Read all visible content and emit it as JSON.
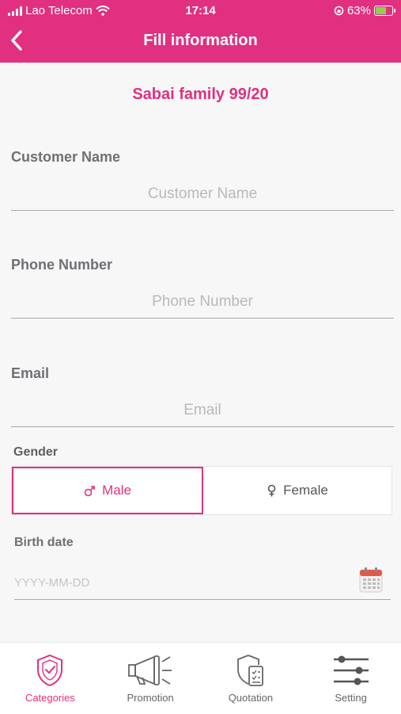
{
  "status": {
    "carrier": "Lao Telecom",
    "time": "17:14",
    "battery": "63%"
  },
  "header": {
    "title": "Fill information"
  },
  "plan": {
    "name": "Sabai family  99/20"
  },
  "form": {
    "customer_name": {
      "label": "Customer Name",
      "placeholder": "Customer Name"
    },
    "phone": {
      "label": "Phone Number",
      "placeholder": "Phone Number"
    },
    "email": {
      "label": "Email",
      "placeholder": "Email"
    },
    "gender": {
      "label": "Gender",
      "male": "Male",
      "female": "Female",
      "selected": "Male"
    },
    "birth": {
      "label": "Birth date",
      "placeholder": "YYYY-MM-DD"
    }
  },
  "tabs": [
    {
      "label": "Categories",
      "icon": "shield-check-icon",
      "active": true
    },
    {
      "label": "Promotion",
      "icon": "megaphone-icon",
      "active": false
    },
    {
      "label": "Quotation",
      "icon": "quotation-icon",
      "active": false
    },
    {
      "label": "Setting",
      "icon": "sliders-icon",
      "active": false
    }
  ],
  "colors": {
    "accent": "#e0307f"
  }
}
